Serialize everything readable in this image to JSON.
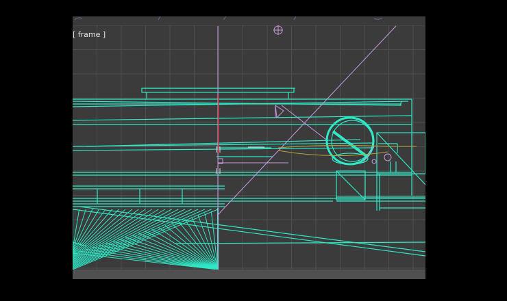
{
  "viewport": {
    "label": "[ frame ]",
    "background": "#3b3b3b",
    "grid_color": "#505050",
    "wire_color": "#2ee8c6",
    "helper_color": "#c89be0",
    "axis_color": "#cc2020"
  }
}
